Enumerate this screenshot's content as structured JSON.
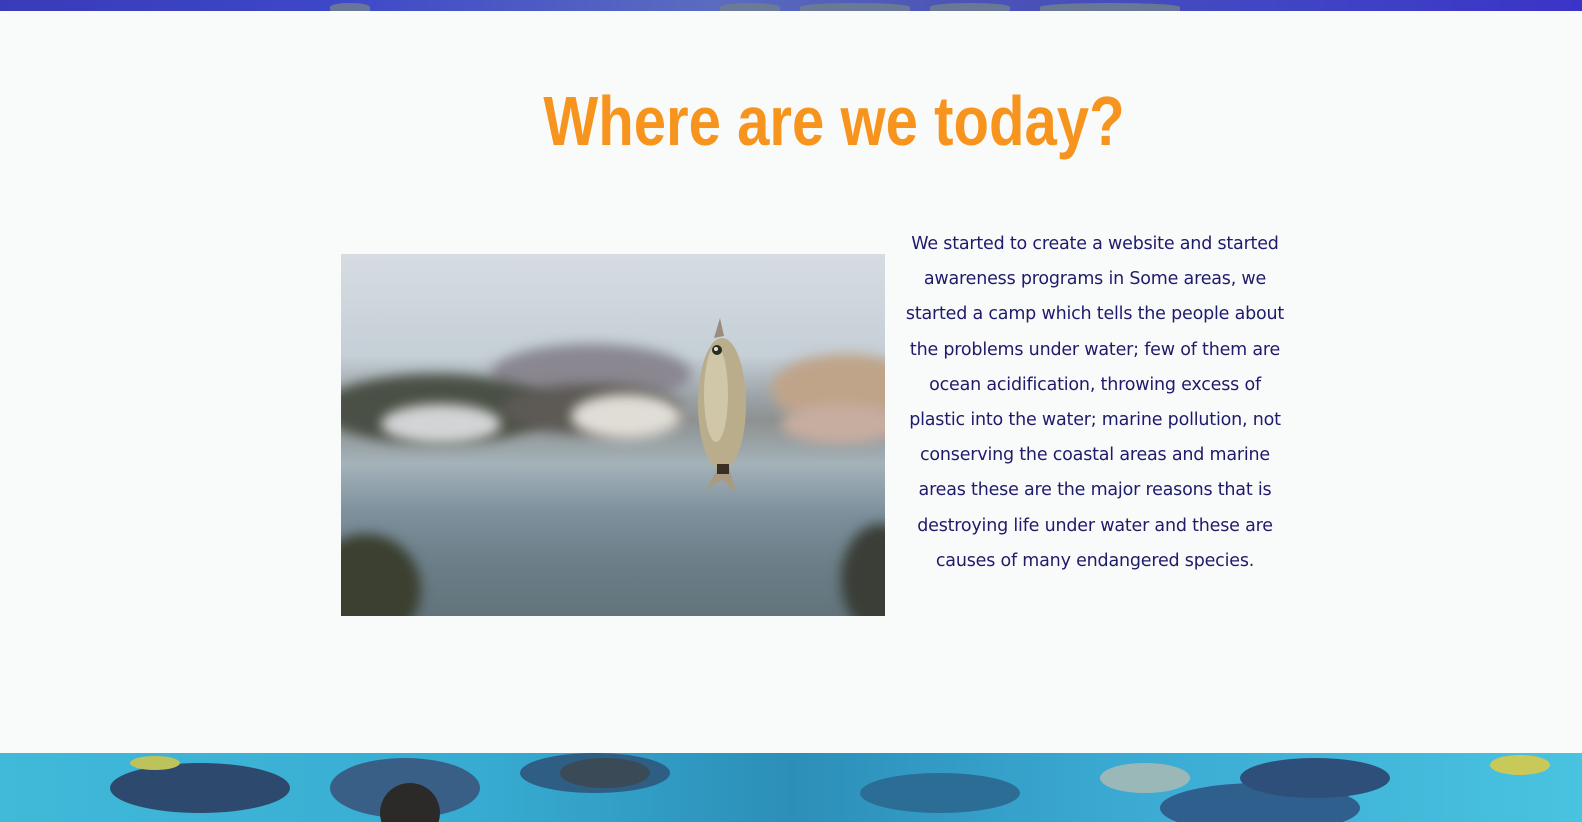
{
  "section": {
    "title": "Where are we today?",
    "body": "We started to create a website and started awareness programs in Some areas, we started a camp which tells the people about the problems under water; few of them are ocean acidification, throwing excess of plastic into the water; marine pollution, not conserving the coastal areas and marine areas these are the major reasons that is destroying life under water and these are causes of many endangered species."
  },
  "colors": {
    "title": "#f7941d",
    "body_text": "#1f1b6b",
    "background": "#f9fafa"
  },
  "images": {
    "photo_subject": "fish-on-hook-photo",
    "bottom_banner": "aquarium-fish-banner",
    "top_banner": "ocean-banner"
  }
}
